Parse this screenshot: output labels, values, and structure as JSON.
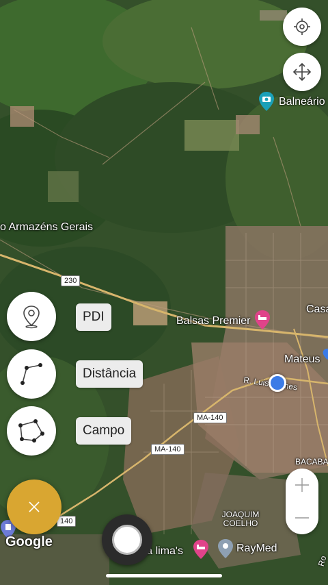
{
  "map": {
    "labels": {
      "armazens": "o Armazéns Gerais",
      "balneario": "Balneário",
      "casa": "Casa",
      "balsas_premier": "Balsas Premier",
      "mateus": "Mateus",
      "rua_luis_gomes": "R. Luis Gomes",
      "bacaba": "BACABA",
      "joaquim_coelho": "JOAQUIM\nCOELHO",
      "lima": "ara lima's",
      "raymed": "RayMed",
      "ro": "Ro"
    },
    "shields": {
      "br230": "230",
      "ma140_a": "MA-140",
      "ma140_b": "MA-140",
      "ma140_c": "140"
    },
    "attribution": "Google"
  },
  "controls": {
    "locate_icon": "crosshair-icon",
    "move_icon": "move-arrows-icon",
    "tools": [
      {
        "label": "PDI",
        "icon": "map-pin-icon"
      },
      {
        "label": "Distância",
        "icon": "polyline-icon"
      },
      {
        "label": "Campo",
        "icon": "polygon-icon"
      }
    ],
    "fab_icon": "close-icon",
    "zoom_in_icon": "plus-icon",
    "zoom_out_icon": "minus-icon"
  },
  "colors": {
    "fab": "#d9a631",
    "label_bg": "#ececec",
    "location_dot": "#3b7be6",
    "hotel_pin": "#e0438a",
    "camera_pin": "#1aa0b8"
  }
}
